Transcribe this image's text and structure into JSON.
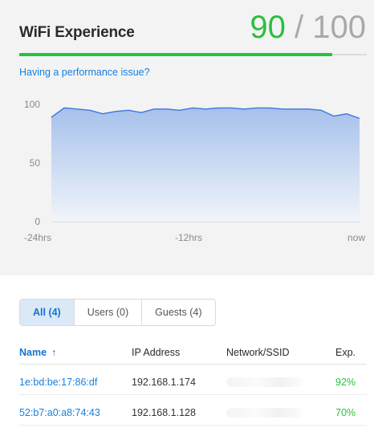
{
  "card": {
    "title": "WiFi Experience",
    "score_value": "90",
    "score_separator": "/",
    "score_max": "100",
    "score_fraction": 0.9,
    "link": "Having a performance issue?"
  },
  "chart_data": {
    "type": "area",
    "y_ticks": [
      "100",
      "50",
      "0"
    ],
    "x_ticks": [
      "-24hrs",
      "-12hrs",
      "now"
    ],
    "ylim": [
      0,
      100
    ],
    "x": [
      -24,
      -23,
      -22,
      -21,
      -20,
      -19,
      -18,
      -17,
      -16,
      -15,
      -14,
      -13,
      -12,
      -11,
      -10,
      -9,
      -8,
      -7,
      -6,
      -5,
      -4,
      -3,
      -2,
      -1,
      0
    ],
    "values": [
      89,
      97,
      96,
      95,
      92,
      94,
      95,
      93,
      96,
      96,
      95,
      97,
      96,
      97,
      97,
      96,
      97,
      97,
      96,
      96,
      96,
      95,
      90,
      92,
      88
    ],
    "colors": {
      "line": "#3d75e0",
      "fill_top": "#a6c1ec",
      "fill_bottom": "#f1f4fa"
    },
    "grid": false
  },
  "tabs": [
    {
      "label": "All (4)",
      "active": true
    },
    {
      "label": "Users (0)",
      "active": false
    },
    {
      "label": "Guests (4)",
      "active": false
    }
  ],
  "table": {
    "headers": {
      "name": "Name",
      "sort_icon": "arrow-up-icon",
      "ip": "IP Address",
      "ssid": "Network/SSID",
      "exp": "Exp."
    },
    "rows": [
      {
        "name": "1e:bd:be:17:86:df",
        "ip": "192.168.1.174",
        "ssid": "",
        "exp": "92%"
      },
      {
        "name": "52:b7:a0:a8:74:43",
        "ip": "192.168.1.128",
        "ssid": "",
        "exp": "70%"
      }
    ]
  },
  "colors": {
    "accent": "#1580e0",
    "good": "#2bbf3f",
    "muted": "#a9a9a9"
  }
}
